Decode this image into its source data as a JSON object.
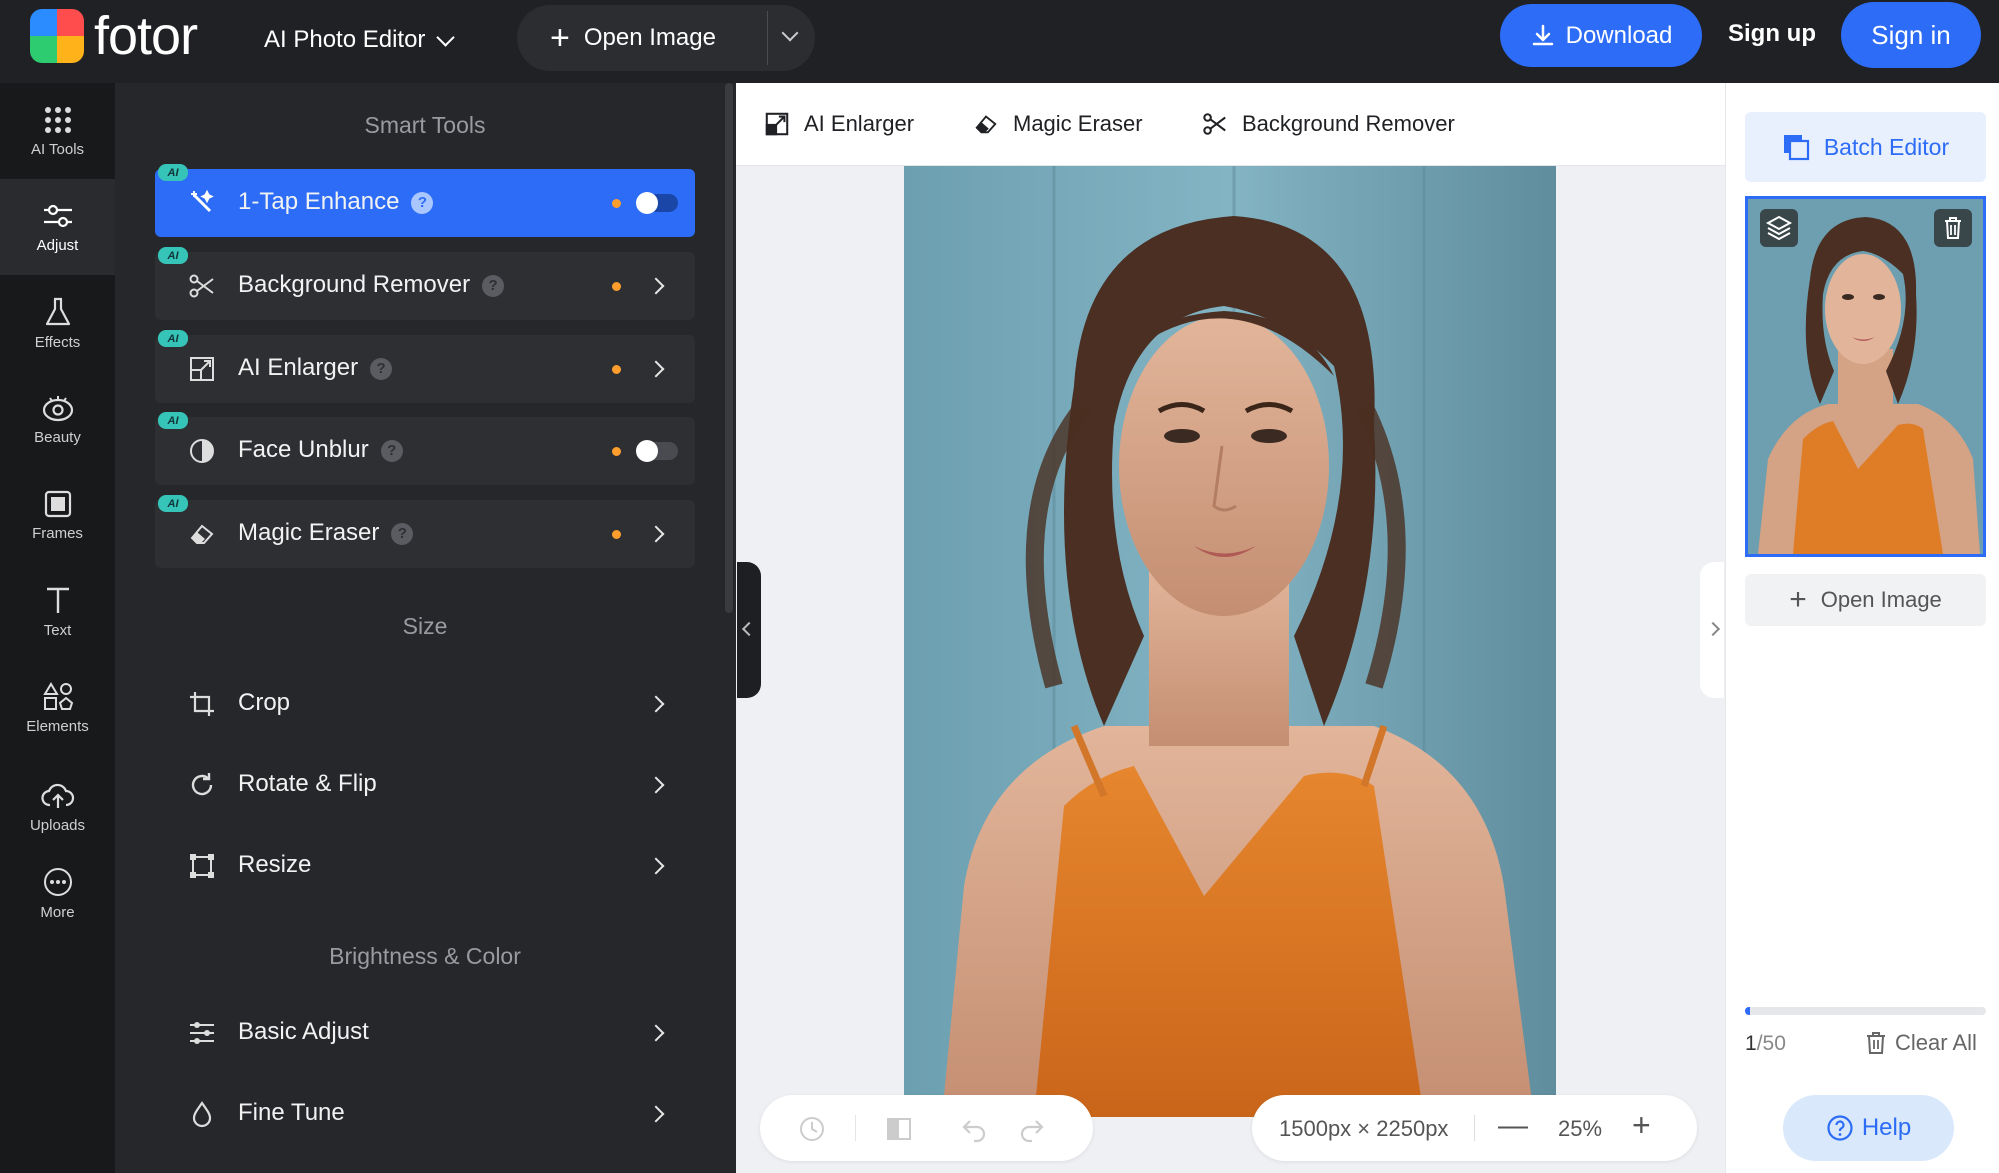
{
  "header": {
    "brand": "fotor",
    "mode_label": "AI Photo Editor",
    "open_image_label": "Open Image",
    "download_label": "Download",
    "sign_up_label": "Sign up",
    "sign_in_label": "Sign in"
  },
  "rail": {
    "items": [
      {
        "label": "AI Tools",
        "icon": "grid-dots-icon"
      },
      {
        "label": "Adjust",
        "icon": "sliders-icon"
      },
      {
        "label": "Effects",
        "icon": "flask-icon"
      },
      {
        "label": "Beauty",
        "icon": "eye-icon"
      },
      {
        "label": "Frames",
        "icon": "frame-icon"
      },
      {
        "label": "Text",
        "icon": "text-icon"
      },
      {
        "label": "Elements",
        "icon": "shapes-icon"
      },
      {
        "label": "Uploads",
        "icon": "cloud-upload-icon"
      },
      {
        "label": "More",
        "icon": "more-icon"
      }
    ],
    "active": "Adjust"
  },
  "panel": {
    "smart_tools_title": "Smart Tools",
    "ai_badge": "AI",
    "smart_tools": [
      {
        "label": "1-Tap Enhance",
        "control": "toggle",
        "active": true
      },
      {
        "label": "Background Remover",
        "control": "arrow"
      },
      {
        "label": "AI Enlarger",
        "control": "arrow"
      },
      {
        "label": "Face Unblur",
        "control": "toggle"
      },
      {
        "label": "Magic Eraser",
        "control": "arrow"
      }
    ],
    "help_glyph": "?",
    "size_title": "Size",
    "size_tools": [
      {
        "label": "Crop"
      },
      {
        "label": "Rotate & Flip"
      },
      {
        "label": "Resize"
      }
    ],
    "brightness_title": "Brightness & Color",
    "brightness_tools": [
      {
        "label": "Basic Adjust"
      },
      {
        "label": "Fine Tune"
      }
    ]
  },
  "canvas_toolbar": {
    "ai_enlarger": "AI Enlarger",
    "magic_eraser": "Magic Eraser",
    "background_remover": "Background Remover"
  },
  "canvas": {
    "dimensions": "1500px × 2250px",
    "zoom": "25%"
  },
  "right_panel": {
    "batch_editor_label": "Batch Editor",
    "open_image_label": "Open Image",
    "count_current": "1",
    "count_total": "/50",
    "progress_fraction": 0.02,
    "clear_all_label": "Clear All",
    "help_label": "Help"
  },
  "colors": {
    "accent": "#2c6cf6",
    "dark_bg": "#202124",
    "panel_bg": "#26272b",
    "ai_badge": "#35c4b7",
    "dot": "#ff9e2c"
  }
}
